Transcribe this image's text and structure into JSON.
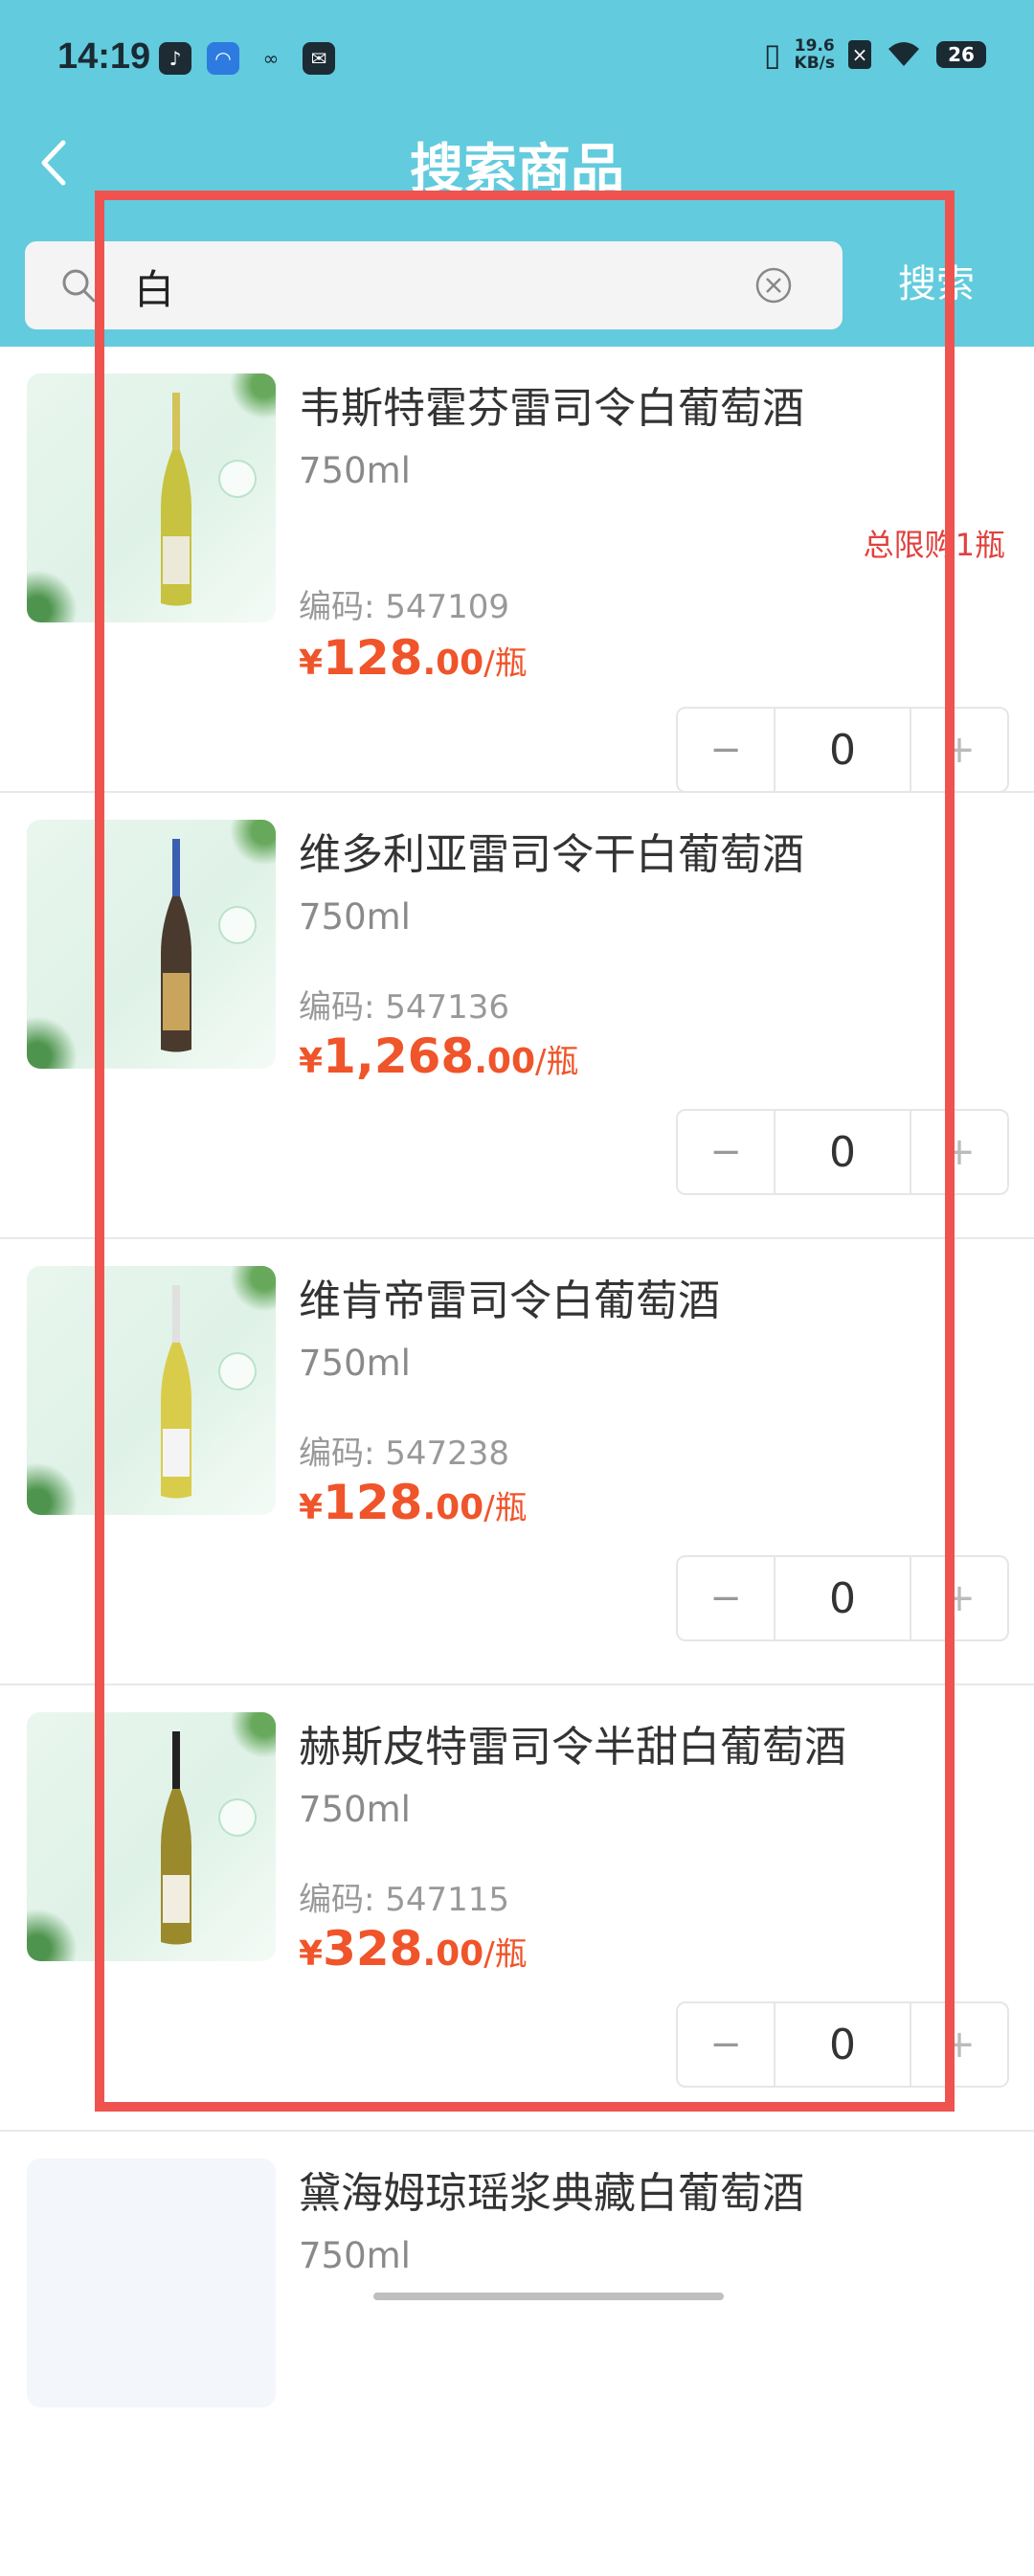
{
  "status_bar": {
    "time": "14:19",
    "net_speed_top": "19.6",
    "net_speed_bottom": "KB/s",
    "battery": "26",
    "icons": [
      "tiktok-icon",
      "app-icon",
      "link-icon",
      "mail-icon",
      "vibrate-icon",
      "sim-x-icon",
      "wifi-icon"
    ]
  },
  "header": {
    "title": "搜索商品",
    "search_value": "白",
    "search_button": "搜索"
  },
  "products": [
    {
      "name": "韦斯特霍芬雷司令白葡萄酒",
      "spec": "750ml",
      "limit": "总限购1瓶",
      "code": "编码: 547109",
      "currency": "¥",
      "price_int": "128",
      "price_dec": ".00",
      "unit": "/瓶",
      "qty": "0",
      "bottle_color": "#c7c23f"
    },
    {
      "name": "维多利亚雷司令干白葡萄酒",
      "spec": "750ml",
      "limit": "",
      "code": "编码: 547136",
      "currency": "¥",
      "price_int": "1,268",
      "price_dec": ".00",
      "unit": "/瓶",
      "qty": "0",
      "bottle_color": "#4a3a2d"
    },
    {
      "name": "维肯帝雷司令白葡萄酒",
      "spec": "750ml",
      "limit": "",
      "code": "编码: 547238",
      "currency": "¥",
      "price_int": "128",
      "price_dec": ".00",
      "unit": "/瓶",
      "qty": "0",
      "bottle_color": "#d9cc4a"
    },
    {
      "name": "赫斯皮特雷司令半甜白葡萄酒",
      "spec": "750ml",
      "limit": "",
      "code": "编码: 547115",
      "currency": "¥",
      "price_int": "328",
      "price_dec": ".00",
      "unit": "/瓶",
      "qty": "0",
      "bottle_color": "#9a8a2c"
    }
  ],
  "partial_product": {
    "name": "黛海姆琼瑶浆典藏白葡萄酒",
    "spec": "750ml"
  },
  "stepper": {
    "minus": "−",
    "plus": "+"
  },
  "colors": {
    "header": "#62cbdd",
    "price": "#f0542a",
    "limit": "#e1413d",
    "highlight": "#ef5350"
  }
}
